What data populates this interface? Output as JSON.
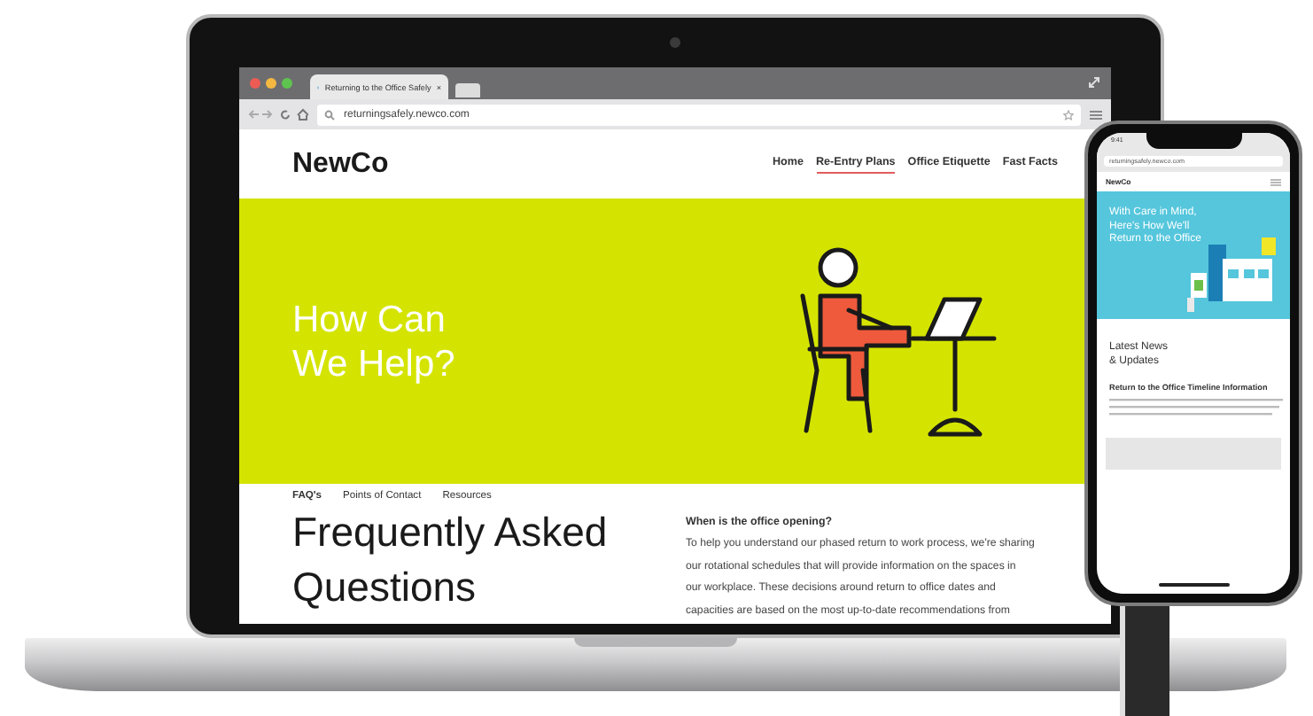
{
  "browser": {
    "tab_title": "Returning to the Office Safely",
    "tab_close": "×",
    "url": "returningsafely.newco.com"
  },
  "site": {
    "logo": "NewCo",
    "nav": [
      {
        "label": "Home",
        "selected": false
      },
      {
        "label": "Re-Entry Plans",
        "selected": true
      },
      {
        "label": "Office Etiquette",
        "selected": false
      },
      {
        "label": "Fast Facts",
        "selected": false
      }
    ],
    "hero_lines": [
      "How Can",
      "We Help?"
    ],
    "subnav": [
      {
        "label": "FAQ's",
        "selected": true
      },
      {
        "label": "Points of Contact",
        "selected": false
      },
      {
        "label": "Resources",
        "selected": false
      }
    ],
    "faq": {
      "title_lines": [
        "Frequently Asked",
        "Questions"
      ],
      "question": "When is the office opening?",
      "answer_lines": [
        "To help you understand our phased return to work process, we're sharing",
        "our rotational schedules that will provide information on the spaces in",
        "our workplace. These decisions around return to office dates and",
        "capacities are based on the most up-to-date recommendations from"
      ]
    }
  },
  "phone": {
    "time": "9:41",
    "url": "returningsafely.newco.com",
    "logo": "NewCo",
    "hero_lines": [
      "With Care in Mind,",
      "Here's How We'll",
      "Return to the Office"
    ],
    "news_lines": [
      "Latest News",
      "& Updates"
    ],
    "section_title": "Return to the Office Timeline Information"
  }
}
